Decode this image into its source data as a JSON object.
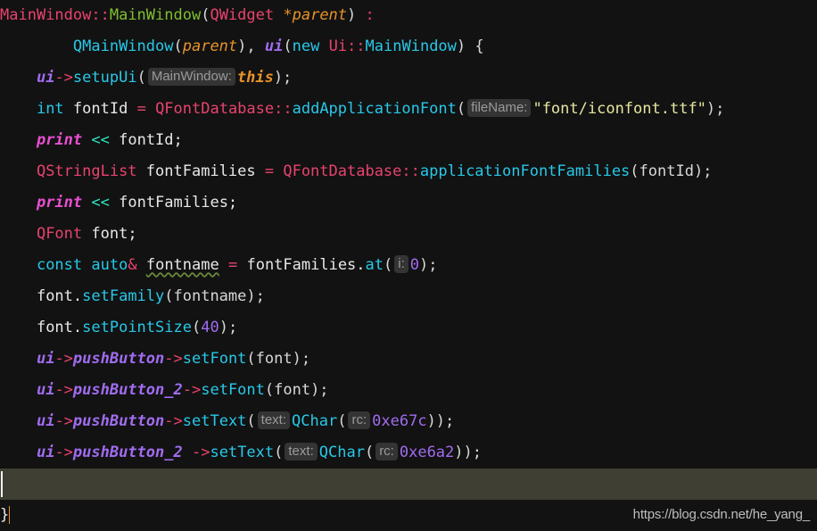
{
  "editor": {
    "background_color": "#121212",
    "current_line_highlight_color": "#403f33",
    "language": "C++",
    "lines": [
      {
        "n": 1,
        "indent": "",
        "segments": [
          {
            "t": "MainWindow",
            "k": "class"
          },
          {
            "t": "::",
            "k": "op"
          },
          {
            "t": "MainWindow",
            "k": "func"
          },
          {
            "t": "(",
            "k": "punct"
          },
          {
            "t": "QWidget",
            "k": "class"
          },
          {
            "t": " ",
            "k": "plain"
          },
          {
            "t": "*",
            "k": "star"
          },
          {
            "t": "parent",
            "k": "param"
          },
          {
            "t": ")",
            "k": "punct"
          },
          {
            "t": " ",
            "k": "plain"
          },
          {
            "t": ":",
            "k": "op"
          }
        ]
      },
      {
        "n": 2,
        "indent": "        ",
        "segments": [
          {
            "t": "QMainWindow",
            "k": "method"
          },
          {
            "t": "(",
            "k": "punct"
          },
          {
            "t": "parent",
            "k": "param"
          },
          {
            "t": "), ",
            "k": "punct"
          },
          {
            "t": "ui",
            "k": "member"
          },
          {
            "t": "(",
            "k": "punct"
          },
          {
            "t": "new",
            "k": "keyword"
          },
          {
            "t": " ",
            "k": "plain"
          },
          {
            "t": "Ui",
            "k": "class"
          },
          {
            "t": "::",
            "k": "op"
          },
          {
            "t": "MainWindow",
            "k": "method"
          },
          {
            "t": ") ",
            "k": "punct"
          },
          {
            "t": "{",
            "k": "brace"
          }
        ]
      },
      {
        "n": 3,
        "indent": "    ",
        "segments": [
          {
            "t": "ui",
            "k": "member"
          },
          {
            "t": "->",
            "k": "op"
          },
          {
            "t": "setupUi",
            "k": "method"
          },
          {
            "t": "(",
            "k": "punct"
          },
          {
            "t": "MainWindow:",
            "k": "hint"
          },
          {
            "t": "this",
            "k": "this"
          },
          {
            "t": ");",
            "k": "punct"
          }
        ]
      },
      {
        "n": 4,
        "indent": "    ",
        "segments": [
          {
            "t": "int",
            "k": "keyword"
          },
          {
            "t": " fontId ",
            "k": "plain"
          },
          {
            "t": "=",
            "k": "op"
          },
          {
            "t": " ",
            "k": "plain"
          },
          {
            "t": "QFontDatabase",
            "k": "class"
          },
          {
            "t": "::",
            "k": "op"
          },
          {
            "t": "addApplicationFont",
            "k": "method"
          },
          {
            "t": "(",
            "k": "punct"
          },
          {
            "t": "fileName:",
            "k": "hint"
          },
          {
            "t": "\"font/iconfont.ttf\"",
            "k": "string"
          },
          {
            "t": ");",
            "k": "punct"
          }
        ]
      },
      {
        "n": 5,
        "indent": "    ",
        "segments": [
          {
            "t": "print",
            "k": "macro"
          },
          {
            "t": " ",
            "k": "plain"
          },
          {
            "t": "<<",
            "k": "shift"
          },
          {
            "t": " fontId;",
            "k": "plain"
          }
        ]
      },
      {
        "n": 6,
        "indent": "    ",
        "segments": [
          {
            "t": "QStringList",
            "k": "class"
          },
          {
            "t": " fontFamilies ",
            "k": "plain"
          },
          {
            "t": "=",
            "k": "op"
          },
          {
            "t": " ",
            "k": "plain"
          },
          {
            "t": "QFontDatabase",
            "k": "class"
          },
          {
            "t": "::",
            "k": "op"
          },
          {
            "t": "applicationFontFamilies",
            "k": "method"
          },
          {
            "t": "(fontId);",
            "k": "punct"
          }
        ]
      },
      {
        "n": 7,
        "indent": "    ",
        "segments": [
          {
            "t": "print",
            "k": "macro"
          },
          {
            "t": " ",
            "k": "plain"
          },
          {
            "t": "<<",
            "k": "shift"
          },
          {
            "t": " fontFamilies;",
            "k": "plain"
          }
        ]
      },
      {
        "n": 8,
        "indent": "    ",
        "segments": [
          {
            "t": "QFont",
            "k": "class"
          },
          {
            "t": " font;",
            "k": "plain"
          }
        ]
      },
      {
        "n": 9,
        "indent": "    ",
        "segments": [
          {
            "t": "const",
            "k": "keyword"
          },
          {
            "t": " ",
            "k": "plain"
          },
          {
            "t": "auto",
            "k": "keyword"
          },
          {
            "t": "&",
            "k": "op"
          },
          {
            "t": " ",
            "k": "plain"
          },
          {
            "t": "fontname",
            "k": "squiggle"
          },
          {
            "t": " ",
            "k": "plain"
          },
          {
            "t": "=",
            "k": "op"
          },
          {
            "t": " fontFamilies.",
            "k": "plain"
          },
          {
            "t": "at",
            "k": "method"
          },
          {
            "t": "(",
            "k": "punct"
          },
          {
            "t": "i:",
            "k": "hint"
          },
          {
            "t": "0",
            "k": "number"
          },
          {
            "t": ");",
            "k": "punct"
          }
        ]
      },
      {
        "n": 10,
        "indent": "    ",
        "segments": [
          {
            "t": "font.",
            "k": "plain"
          },
          {
            "t": "setFamily",
            "k": "method"
          },
          {
            "t": "(fontname);",
            "k": "punct"
          }
        ]
      },
      {
        "n": 11,
        "indent": "    ",
        "segments": [
          {
            "t": "font.",
            "k": "plain"
          },
          {
            "t": "setPointSize",
            "k": "method"
          },
          {
            "t": "(",
            "k": "punct"
          },
          {
            "t": "40",
            "k": "number"
          },
          {
            "t": ");",
            "k": "punct"
          }
        ]
      },
      {
        "n": 12,
        "indent": "    ",
        "segments": [
          {
            "t": "ui",
            "k": "member"
          },
          {
            "t": "->",
            "k": "op"
          },
          {
            "t": "pushButton",
            "k": "member"
          },
          {
            "t": "->",
            "k": "op"
          },
          {
            "t": "setFont",
            "k": "method"
          },
          {
            "t": "(font);",
            "k": "punct"
          }
        ]
      },
      {
        "n": 13,
        "indent": "    ",
        "segments": [
          {
            "t": "ui",
            "k": "member"
          },
          {
            "t": "->",
            "k": "op"
          },
          {
            "t": "pushButton_2",
            "k": "member"
          },
          {
            "t": "->",
            "k": "op"
          },
          {
            "t": "setFont",
            "k": "method"
          },
          {
            "t": "(font);",
            "k": "punct"
          }
        ]
      },
      {
        "n": 14,
        "indent": "    ",
        "segments": [
          {
            "t": "ui",
            "k": "member"
          },
          {
            "t": "->",
            "k": "op"
          },
          {
            "t": "pushButton",
            "k": "member"
          },
          {
            "t": "->",
            "k": "op"
          },
          {
            "t": "setText",
            "k": "method"
          },
          {
            "t": "(",
            "k": "punct"
          },
          {
            "t": "text:",
            "k": "hint"
          },
          {
            "t": "QChar",
            "k": "method"
          },
          {
            "t": "(",
            "k": "punct"
          },
          {
            "t": "rc:",
            "k": "hint"
          },
          {
            "t": "0xe67c",
            "k": "number"
          },
          {
            "t": "));",
            "k": "punct"
          }
        ]
      },
      {
        "n": 15,
        "indent": "    ",
        "segments": [
          {
            "t": "ui",
            "k": "member"
          },
          {
            "t": "->",
            "k": "op"
          },
          {
            "t": "pushButton_2",
            "k": "member"
          },
          {
            "t": " ",
            "k": "plain"
          },
          {
            "t": "->",
            "k": "op"
          },
          {
            "t": "setText",
            "k": "method"
          },
          {
            "t": "(",
            "k": "punct"
          },
          {
            "t": "text:",
            "k": "hint"
          },
          {
            "t": "QChar",
            "k": "method"
          },
          {
            "t": "(",
            "k": "punct"
          },
          {
            "t": "rc:",
            "k": "hint"
          },
          {
            "t": "0xe6a2",
            "k": "number"
          },
          {
            "t": "));",
            "k": "punct"
          }
        ]
      },
      {
        "n": 16,
        "indent": "",
        "current": true,
        "segments": []
      },
      {
        "n": 17,
        "indent": "",
        "segments": [
          {
            "t": "}",
            "k": "brace-match"
          }
        ]
      }
    ]
  },
  "watermark": {
    "text": "https://blog.csdn.net/he_yang_"
  }
}
